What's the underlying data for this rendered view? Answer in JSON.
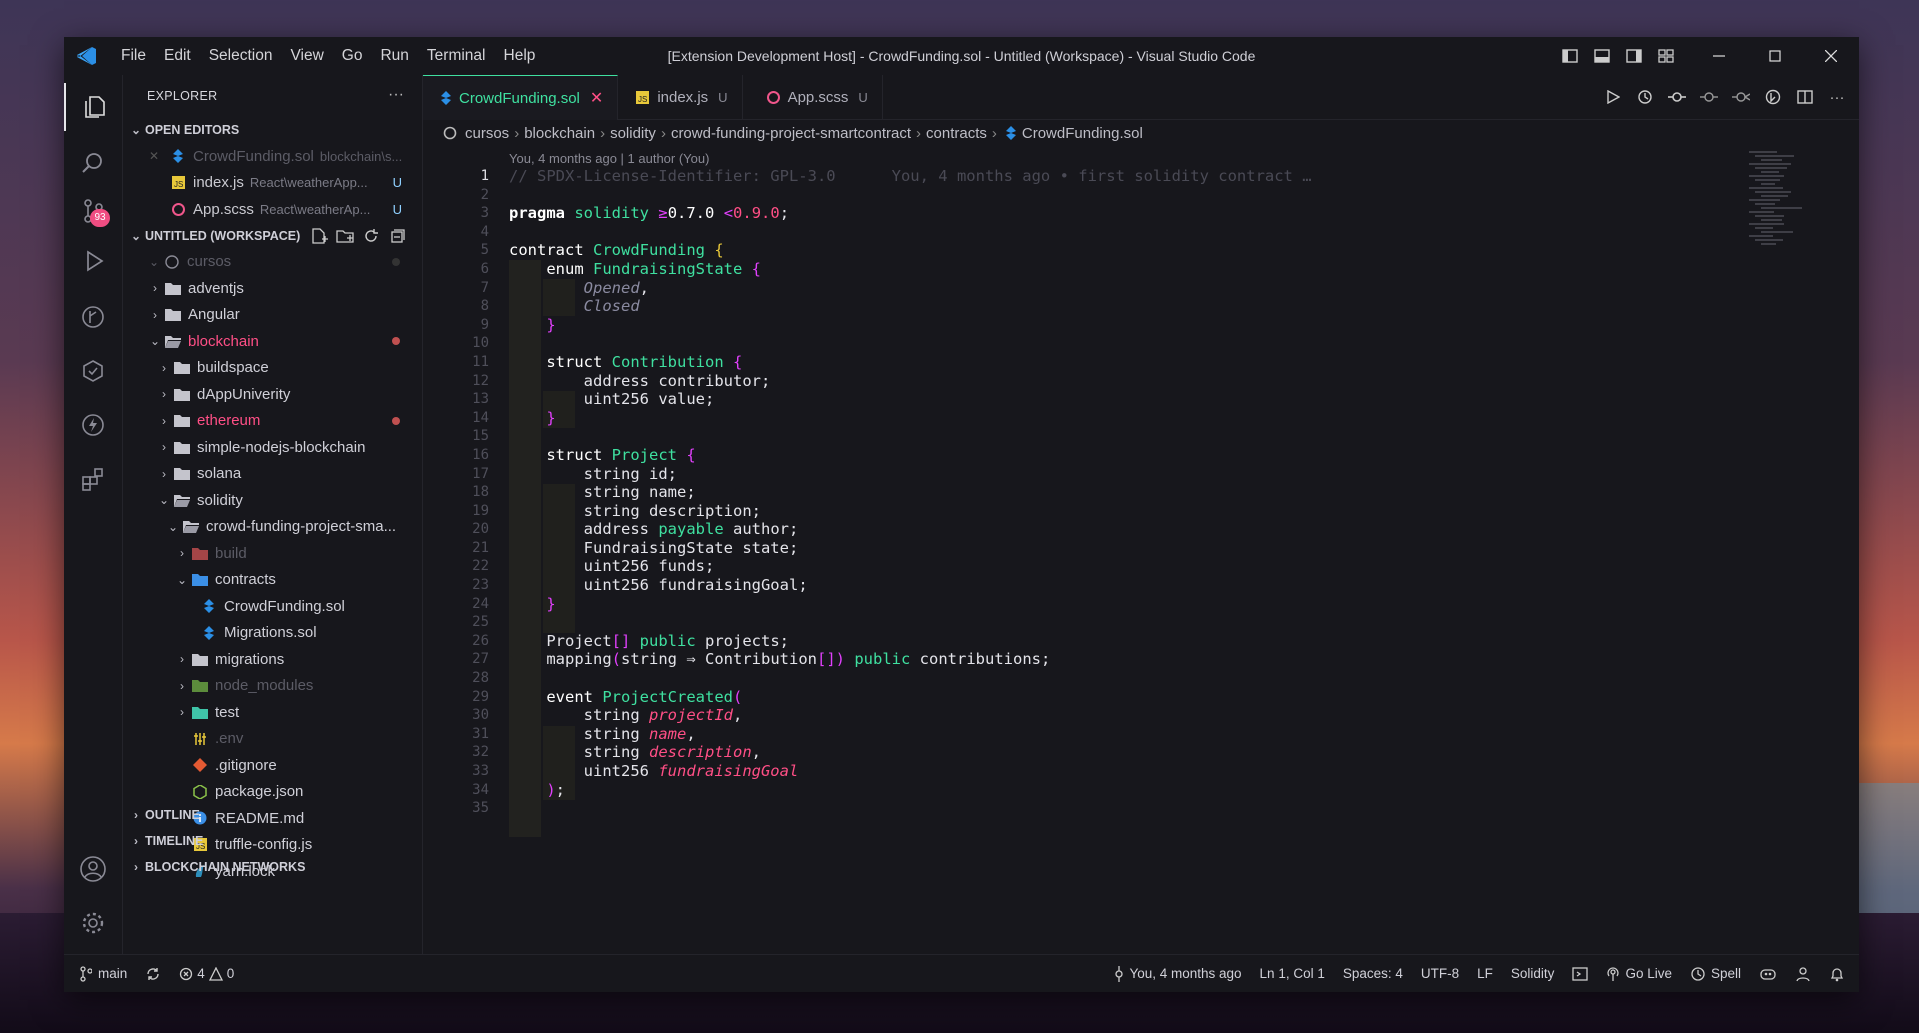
{
  "window": {
    "title": "[Extension Development Host] - CrowdFunding.sol - Untitled (Workspace) - Visual Studio Code",
    "menu": [
      "File",
      "Edit",
      "Selection",
      "View",
      "Go",
      "Run",
      "Terminal",
      "Help"
    ]
  },
  "activity": {
    "scm_badge": "93"
  },
  "sidebar": {
    "header": "EXPLORER",
    "more": "···",
    "open_editors": {
      "title": "OPEN EDITORS",
      "items": [
        {
          "name": "CrowdFunding.sol",
          "desc": "blockchain\\s...",
          "status": ""
        },
        {
          "name": "index.js",
          "desc": "React\\weatherApp...",
          "status": "U"
        },
        {
          "name": "App.scss",
          "desc": "React\\weatherAp...",
          "status": "U"
        }
      ]
    },
    "workspace": {
      "title": "UNTITLED (WORKSPACE)",
      "root": "cursos",
      "tree": [
        {
          "label": "adventjs"
        },
        {
          "label": "Angular"
        },
        {
          "label": "blockchain"
        },
        {
          "label": "buildspace"
        },
        {
          "label": "dAppUniverity"
        },
        {
          "label": "ethereum"
        },
        {
          "label": "simple-nodejs-blockchain"
        },
        {
          "label": "solana"
        },
        {
          "label": "solidity"
        },
        {
          "label": "crowd-funding-project-sma..."
        },
        {
          "label": "build"
        },
        {
          "label": "contracts"
        },
        {
          "label": "CrowdFunding.sol"
        },
        {
          "label": "Migrations.sol"
        },
        {
          "label": "migrations"
        },
        {
          "label": "node_modules"
        },
        {
          "label": "test"
        },
        {
          "label": ".env"
        },
        {
          "label": ".gitignore"
        },
        {
          "label": "package.json"
        },
        {
          "label": "README.md"
        },
        {
          "label": "truffle-config.js"
        },
        {
          "label": "yarn.lock"
        }
      ]
    },
    "outline": "OUTLINE",
    "timeline": "TIMELINE",
    "networks": "BLOCKCHAIN NETWORKS"
  },
  "tabs": [
    {
      "label": "CrowdFunding.sol",
      "status": ""
    },
    {
      "label": "index.js",
      "status": "U"
    },
    {
      "label": "App.scss",
      "status": "U"
    }
  ],
  "breadcrumb": [
    "cursos",
    "blockchain",
    "solidity",
    "crowd-funding-project-smartcontract",
    "contracts",
    "CrowdFunding.sol"
  ],
  "editor": {
    "blame_header": "You, 4 months ago | 1 author (You)",
    "line_numbers": [
      "1",
      "2",
      "3",
      "4",
      "5",
      "6",
      "7",
      "8",
      "9",
      "10",
      "11",
      "12",
      "13",
      "14",
      "15",
      "16",
      "17",
      "18",
      "19",
      "20",
      "21",
      "22",
      "23",
      "24",
      "25",
      "26",
      "27",
      "28",
      "29",
      "30",
      "31",
      "32",
      "33",
      "34",
      "35"
    ],
    "code": {
      "l1_comment": "// SPDX-License-Identifier: GPL-3.0",
      "l1_blame": "You, 4 months ago • first solidity contract …",
      "pragma": "pragma",
      "solidity": "solidity",
      "ver_min": "0.7.0",
      "ver_max": "0.9.0",
      "contract": "contract",
      "contract_name": "CrowdFunding",
      "enum": "enum",
      "enum_name": "FundraisingState",
      "opened": "Opened",
      "closed": "Closed",
      "struct": "struct",
      "contribution": "Contribution",
      "address": "address",
      "contributor": "contributor",
      "uint256": "uint256",
      "value": "value",
      "project": "Project",
      "string": "string",
      "id": "id",
      "name": "name",
      "description": "description",
      "payable": "payable",
      "author": "author",
      "state": "state",
      "funds": "funds",
      "fundraisingGoal": "fundraisingGoal",
      "public": "public",
      "projects": "projects",
      "mapping": "mapping",
      "contributions": "contributions",
      "event": "event",
      "event_name": "ProjectCreated",
      "projectId": "projectId"
    }
  },
  "statusbar": {
    "branch": "main",
    "errors": "4",
    "warnings": "0",
    "blame": "You, 4 months ago",
    "position": "Ln 1, Col 1",
    "spaces": "Spaces: 4",
    "encoding": "UTF-8",
    "eol": "LF",
    "language": "Solidity",
    "golive": "Go Live",
    "spell": "Spell"
  },
  "colors": {
    "accent": "#3fe0a0",
    "keyword_pink": "#ff4f86",
    "bracket": "#e040fb",
    "bg": "#17171c"
  }
}
